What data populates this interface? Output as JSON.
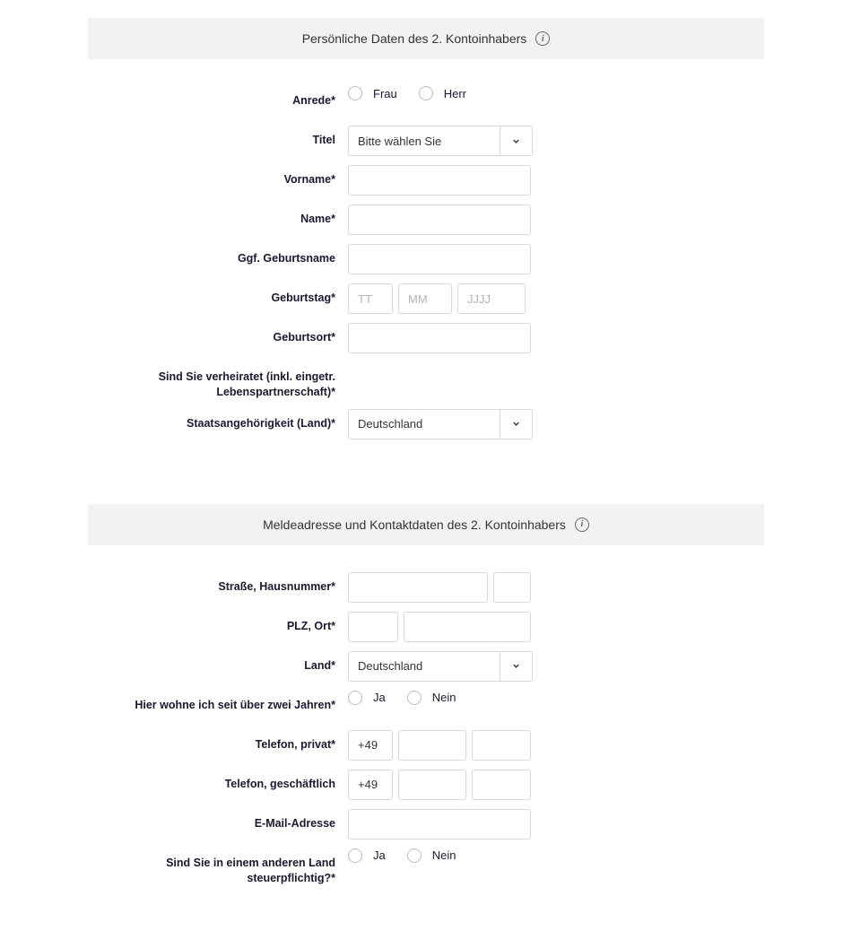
{
  "sections": {
    "personal": {
      "title": "Persönliche Daten des 2. Kontoinhabers"
    },
    "contact": {
      "title": "Meldeadresse und Kontaktdaten des 2. Kontoinhabers"
    }
  },
  "labels": {
    "salutation": "Anrede*",
    "title": "Titel",
    "firstname": "Vorname*",
    "lastname": "Name*",
    "birthname": "Ggf. Geburtsname",
    "birthday": "Geburtstag*",
    "birthplace": "Geburtsort*",
    "married": "Sind Sie verheiratet (inkl. eingetr. Lebenspartnerschaft)*",
    "nationality": "Staatsangehörigkeit (Land)*",
    "street": "Straße, Hausnummer*",
    "zipcity": "PLZ, Ort*",
    "country": "Land*",
    "residence2y": "Hier wohne ich seit über zwei Jahren*",
    "phone_private": "Telefon, privat*",
    "phone_business": "Telefon, geschäftlich",
    "email": "E-Mail-Adresse",
    "tax_foreign": "Sind Sie in einem anderen Land steuerpflichtig?*"
  },
  "options": {
    "frau": "Frau",
    "herr": "Herr",
    "ja": "Ja",
    "nein": "Nein"
  },
  "placeholders": {
    "title_select": "Bitte wählen Sie",
    "day": "TT",
    "month": "MM",
    "year": "JJJJ"
  },
  "values": {
    "nationality": "Deutschland",
    "country": "Deutschland",
    "phone_private_cc": "+49",
    "phone_business_cc": "+49"
  }
}
